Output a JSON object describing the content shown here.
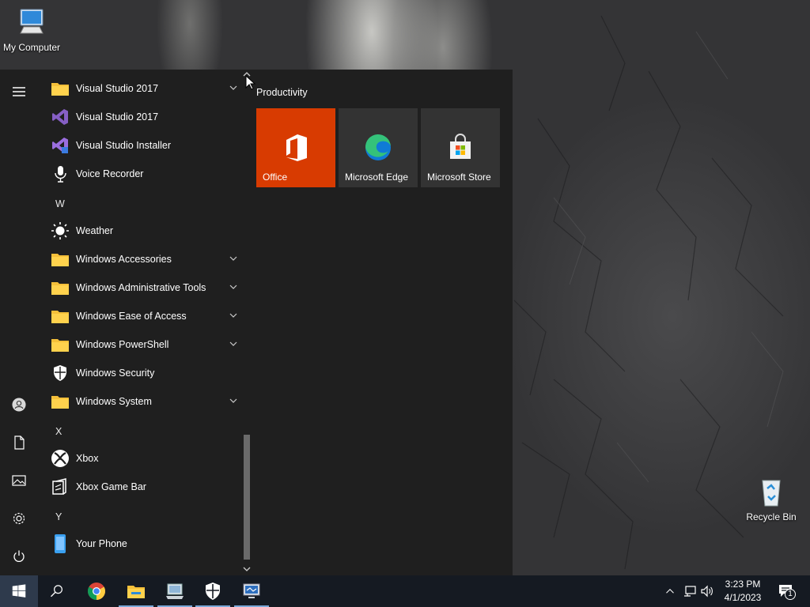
{
  "desktop": {
    "icons": [
      {
        "label": "My Computer",
        "icon": "computer-icon"
      },
      {
        "label": "Recycle Bin",
        "icon": "recycle-bin-icon"
      }
    ]
  },
  "start_menu": {
    "rail": [
      "menu-icon",
      "user-icon",
      "documents-icon",
      "pictures-icon",
      "settings-icon",
      "power-icon"
    ],
    "apps": [
      {
        "label": "Visual Studio 2017",
        "icon": "folder-icon",
        "expandable": true
      },
      {
        "label": "Visual Studio 2017",
        "icon": "visual-studio-icon"
      },
      {
        "label": "Visual Studio Installer",
        "icon": "vs-installer-icon"
      },
      {
        "label": "Voice Recorder",
        "icon": "microphone-icon"
      },
      {
        "label": "W",
        "type": "letter"
      },
      {
        "label": "Weather",
        "icon": "sun-icon"
      },
      {
        "label": "Windows Accessories",
        "icon": "folder-icon",
        "expandable": true
      },
      {
        "label": "Windows Administrative Tools",
        "icon": "folder-icon",
        "expandable": true
      },
      {
        "label": "Windows Ease of Access",
        "icon": "folder-icon",
        "expandable": true
      },
      {
        "label": "Windows PowerShell",
        "icon": "folder-icon",
        "expandable": true
      },
      {
        "label": "Windows Security",
        "icon": "shield-icon"
      },
      {
        "label": "Windows System",
        "icon": "folder-icon",
        "expandable": true
      },
      {
        "label": "X",
        "type": "letter"
      },
      {
        "label": "Xbox",
        "icon": "xbox-icon"
      },
      {
        "label": "Xbox Game Bar",
        "icon": "game-bar-icon"
      },
      {
        "label": "Y",
        "type": "letter"
      },
      {
        "label": "Your Phone",
        "icon": "phone-icon"
      }
    ],
    "tile_group": "Productivity",
    "tiles": [
      {
        "label": "Office",
        "icon": "office-icon",
        "color": "#d83b01"
      },
      {
        "label": "Microsoft Edge",
        "icon": "edge-icon",
        "color": "#333333"
      },
      {
        "label": "Microsoft Store",
        "icon": "store-icon",
        "color": "#333333"
      }
    ]
  },
  "taskbar": {
    "buttons": [
      "windows-start-icon",
      "search-icon",
      "chrome-icon",
      "file-explorer-icon",
      "network-computer-icon",
      "windows-security-icon",
      "remote-desktop-icon"
    ],
    "tray": [
      "chevron-up-icon",
      "network-icon",
      "volume-icon"
    ],
    "time": "3:23 PM",
    "date": "4/1/2023",
    "notification_count": "1"
  }
}
